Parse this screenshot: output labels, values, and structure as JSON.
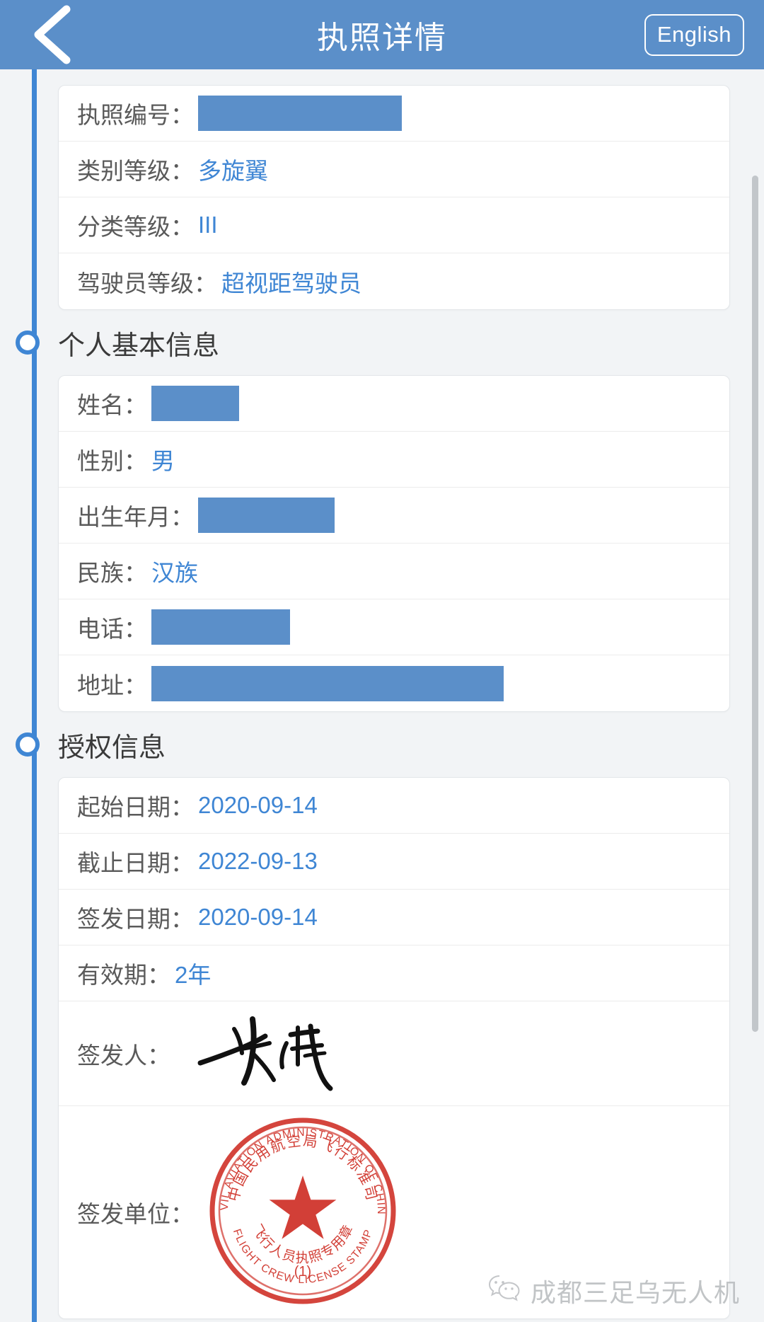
{
  "header": {
    "back_icon": "chevron-left-icon",
    "title": "执照详情",
    "language_button": "English"
  },
  "license_card": {
    "rows": [
      {
        "label": "执照编号：",
        "value": "",
        "redacted": true,
        "redact_width": 288
      },
      {
        "label": "类别等级：",
        "value": "多旋翼",
        "redacted": false
      },
      {
        "label": "分类等级：",
        "value": "III",
        "redacted": false
      },
      {
        "label": "驾驶员等级：",
        "value": "超视距驾驶员",
        "redacted": false
      }
    ]
  },
  "personal_section": {
    "title": "个人基本信息",
    "marker_icon": "timeline-circle-icon",
    "rows": [
      {
        "label": "姓名：",
        "value": "",
        "redacted": true,
        "redact_width": 124
      },
      {
        "label": "性别：",
        "value": "男",
        "redacted": false
      },
      {
        "label": "出生年月：",
        "value": "",
        "redacted": true,
        "redact_width": 193
      },
      {
        "label": "民族：",
        "value": "汉族",
        "redacted": false
      },
      {
        "label": "电话：",
        "value": "",
        "redacted": true,
        "redact_width": 196
      },
      {
        "label": "地址：",
        "value": "",
        "redacted": true,
        "redact_width": 498
      }
    ]
  },
  "authorization_section": {
    "title": "授权信息",
    "marker_icon": "timeline-circle-icon",
    "rows": [
      {
        "label": "起始日期：",
        "value": "2020-09-14",
        "redacted": false
      },
      {
        "label": "截止日期：",
        "value": "2022-09-13",
        "redacted": false
      },
      {
        "label": "签发日期：",
        "value": "2020-09-14",
        "redacted": false
      },
      {
        "label": "有效期：",
        "value": "2年",
        "redacted": false
      }
    ],
    "signer_label": "签发人：",
    "signer_signature_icon": "handwritten-signature-icon",
    "issuer_label": "签发单位：",
    "seal": {
      "icon": "official-red-seal-icon",
      "outer_text_en": "CIVIL AVIATION ADMINISTRATION OF CHINA",
      "outer_text_cn": "中国民用航空局飞行标准司",
      "inner_text_cn": "飞行人员执照专用章",
      "bottom_text_en": "FLIGHT CREW LICENSE STAMP",
      "number": "(1)",
      "color": "#d0352c"
    }
  },
  "watermark": {
    "icon": "wechat-icon",
    "text": "成都三足乌无人机"
  },
  "colors": {
    "header_bg": "#5b8fc9",
    "accent": "#3f86d4",
    "redact": "#5b8fc9",
    "page_bg": "#f2f4f6",
    "card_bg": "#ffffff",
    "label": "#5a5a5a"
  }
}
